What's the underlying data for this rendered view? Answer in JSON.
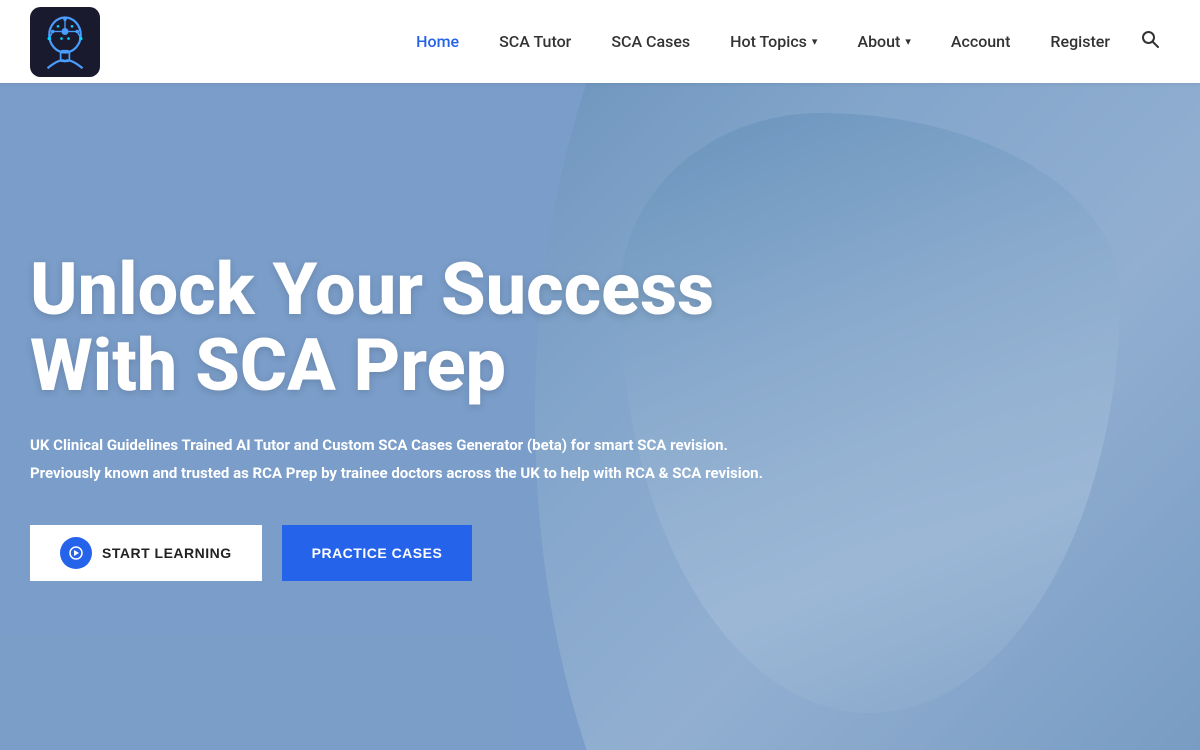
{
  "header": {
    "logo_alt": "SCA Prep Logo",
    "nav_items": [
      {
        "id": "home",
        "label": "Home",
        "active": true,
        "has_dropdown": false
      },
      {
        "id": "sca-tutor",
        "label": "SCA Tutor",
        "active": false,
        "has_dropdown": false
      },
      {
        "id": "sca-cases",
        "label": "SCA Cases",
        "active": false,
        "has_dropdown": false
      },
      {
        "id": "hot-topics",
        "label": "Hot Topics",
        "active": false,
        "has_dropdown": true
      },
      {
        "id": "about",
        "label": "About",
        "active": false,
        "has_dropdown": true
      },
      {
        "id": "account",
        "label": "Account",
        "active": false,
        "has_dropdown": false
      },
      {
        "id": "register",
        "label": "Register",
        "active": false,
        "has_dropdown": false
      }
    ],
    "search_icon": "🔍"
  },
  "hero": {
    "title": "Unlock Your Success With SCA Prep",
    "subtitle1": "UK Clinical Guidelines Trained AI Tutor and Custom SCA Cases Generator (beta) for smart SCA revision.",
    "subtitle2": "Previously known and trusted as RCA Prep by trainee doctors across the UK to help with RCA & SCA revision.",
    "btn_start_label": "START LEARNING",
    "btn_practice_label": "PRACTICE CASES"
  }
}
